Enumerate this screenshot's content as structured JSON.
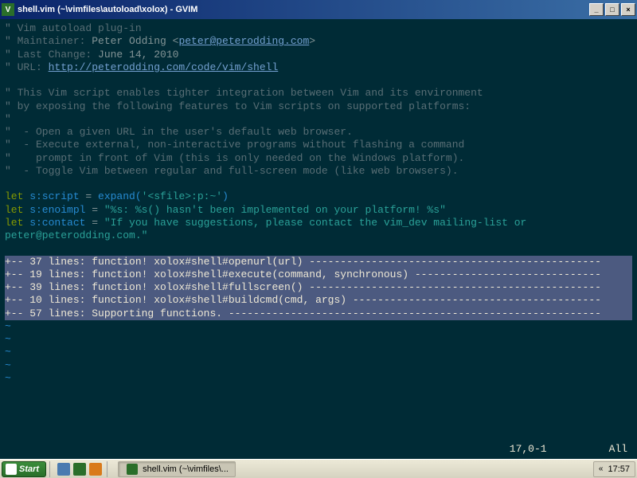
{
  "window": {
    "title": "shell.vim (~\\vimfiles\\autoload\\xolox) - GVIM",
    "min": "_",
    "max": "□",
    "close": "×"
  },
  "code": {
    "c1": "\" Vim autoload plug-in",
    "c2_pre": "\" Maintainer: ",
    "c2_name": "Peter Odding <",
    "c2_email": "peter@peterodding.com",
    "c2_post": ">",
    "c3_pre": "\" Last Change: ",
    "c3_date": "June 14, 2010",
    "c4_pre": "\" URL: ",
    "c4_url": "http://peterodding.com/code/vim/shell",
    "c5": "\" This Vim script enables tighter integration between Vim and its environment",
    "c6": "\" by exposing the following features to Vim scripts on supported platforms:",
    "c7": "\"",
    "c8": "\"  - Open a given URL in the user's default web browser.",
    "c9": "\"  - Execute external, non-interactive programs without flashing a command",
    "c10": "\"    prompt in front of Vim (this is only needed on the Windows platform).",
    "c11": "\"  - Toggle Vim between regular and full-screen mode (like web browsers).",
    "let": "let",
    "v1": " s:script ",
    "eq": "= ",
    "fn1": "expand(",
    "s1": "'<sfile>:p:~'",
    "fn1c": ")",
    "v2": " s:enoimpl ",
    "s2": "\"%s: %s() hasn't been implemented on your platform! %s\"",
    "v3": " s:contact ",
    "s3a": "\"If you have suggestions, please contact the vim_dev mailing-list or ",
    "s3b": "peter@peterodding.com.\""
  },
  "folds": [
    "+-- 37 lines: function! xolox#shell#openurl(url) -----------------------------------------------",
    "+-- 19 lines: function! xolox#shell#execute(command, synchronous) ------------------------------",
    "+-- 39 lines: function! xolox#shell#fullscreen() -----------------------------------------------",
    "+-- 10 lines: function! xolox#shell#buildcmd(cmd, args) ----------------------------------------",
    "+-- 57 lines: Supporting functions. ------------------------------------------------------------"
  ],
  "tilde": "~",
  "status": {
    "pos": "17,0-1",
    "pct": "All"
  },
  "taskbar": {
    "start": "Start",
    "task": "shell.vim (~\\vimfiles\\...",
    "clock": "17:57",
    "arrow": "«"
  }
}
